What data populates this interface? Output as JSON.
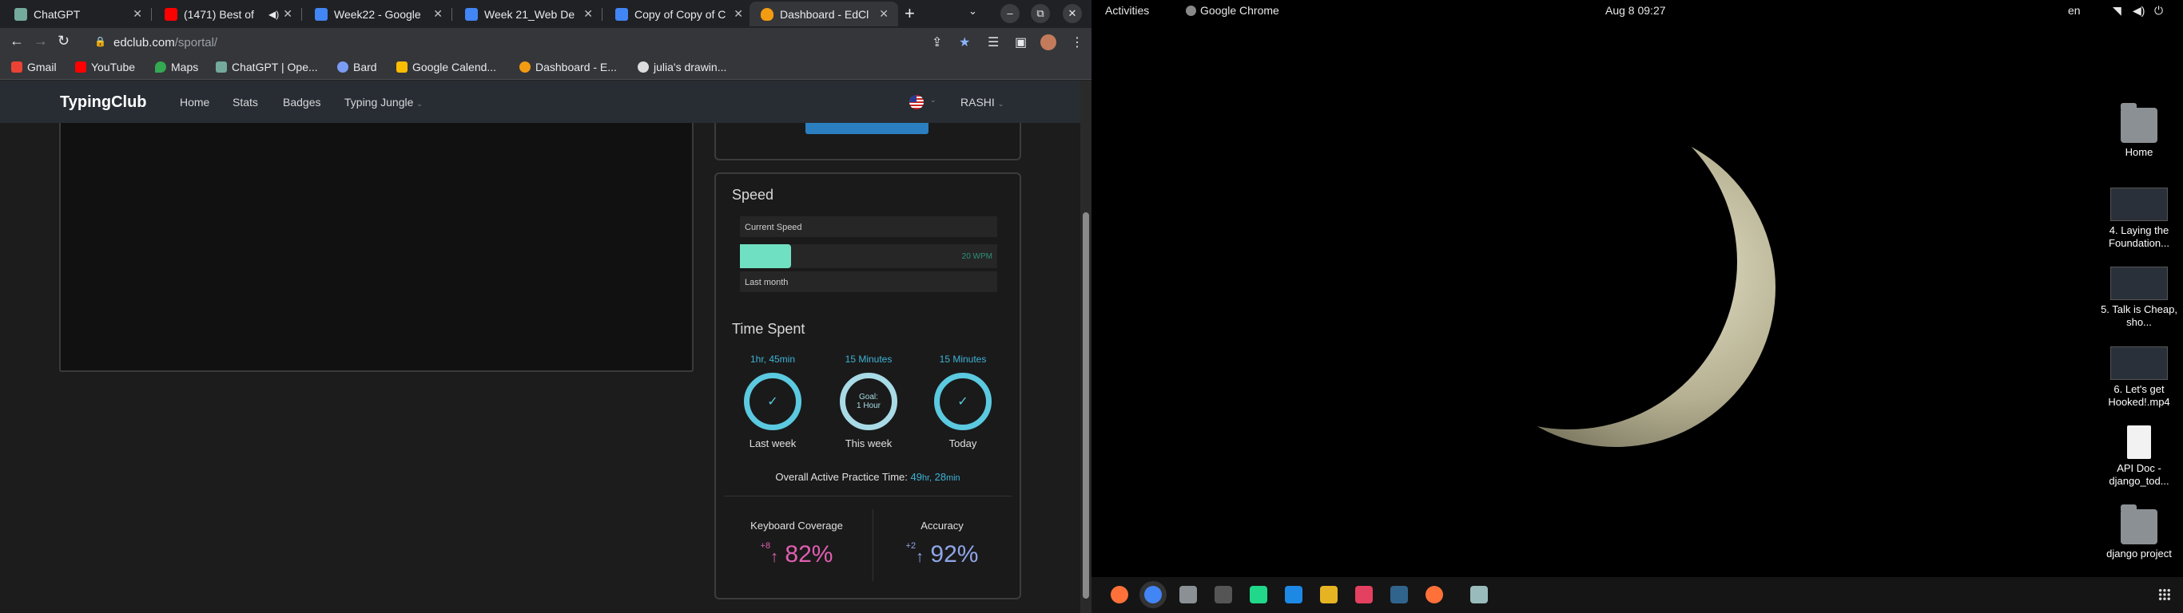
{
  "browser": {
    "tabs": [
      {
        "title": "ChatGPT",
        "color": "#74aa9c"
      },
      {
        "title": "(1471) Best of",
        "color": "#ff0000"
      },
      {
        "title": "Week22 - Google",
        "color": "#4285f4"
      },
      {
        "title": "Week 21_Web De",
        "color": "#4285f4"
      },
      {
        "title": "Copy of Copy of C",
        "color": "#4285f4"
      },
      {
        "title": "Dashboard - EdCl",
        "color": "#f39c12"
      }
    ],
    "url_host": "edclub.com",
    "url_path": "/sportal/",
    "bookmarks": [
      "Gmail",
      "YouTube",
      "Maps",
      "ChatGPT | Ope...",
      "Bard",
      "Google Calend...",
      "Dashboard - E...",
      "julia's drawin..."
    ]
  },
  "site": {
    "logo": "TypingClub",
    "nav": [
      "Home",
      "Stats",
      "Badges",
      "Typing Jungle"
    ],
    "user": "RASHI"
  },
  "speed": {
    "title": "Speed",
    "current_label": "Current Speed",
    "value_label": "20 WPM",
    "fill_fraction": 0.2,
    "last_month_label": "Last month"
  },
  "time": {
    "title": "Time Spent",
    "rings": [
      {
        "top": "1hr, 45min",
        "center": "✓",
        "bottom": "Last week"
      },
      {
        "top": "15 Minutes",
        "center": "Goal:\n1 Hour",
        "bottom": "This week"
      },
      {
        "top": "15 Minutes",
        "center": "✓",
        "bottom": "Today"
      }
    ],
    "overall_label": "Overall Active Practice Time:",
    "overall_hr": "49",
    "overall_hr_unit": "hr,",
    "overall_min": "28",
    "overall_min_unit": "min"
  },
  "stats": {
    "coverage_label": "Keyboard Coverage",
    "coverage_delta": "+8",
    "coverage_value": "82%",
    "coverage_color": "#e05fb0",
    "accuracy_label": "Accuracy",
    "accuracy_delta": "+2",
    "accuracy_value": "92%",
    "accuracy_color": "#8fa6e8"
  },
  "desktop": {
    "activities": "Activities",
    "app": "Google Chrome",
    "clock": "Aug 8  09:27",
    "lang": "en",
    "icons": [
      {
        "label": "Home",
        "kind": "folder"
      },
      {
        "label": "4. Laying the Foundation...",
        "kind": "thumb"
      },
      {
        "label": "5. Talk is Cheap, sho...",
        "kind": "thumb"
      },
      {
        "label": "6. Let's get Hooked!.mp4",
        "kind": "thumb"
      },
      {
        "label": "API Doc - django_tod...",
        "kind": "doc"
      },
      {
        "label": "django project",
        "kind": "folder"
      }
    ],
    "dock_colors": [
      "#ff7139",
      "#4285f4",
      "#8a9093",
      "#555",
      "#21d789",
      "#1e88e5",
      "#e6b422",
      "#e4405f",
      "#31648c",
      "#ff7139",
      "#9bb"
    ]
  }
}
